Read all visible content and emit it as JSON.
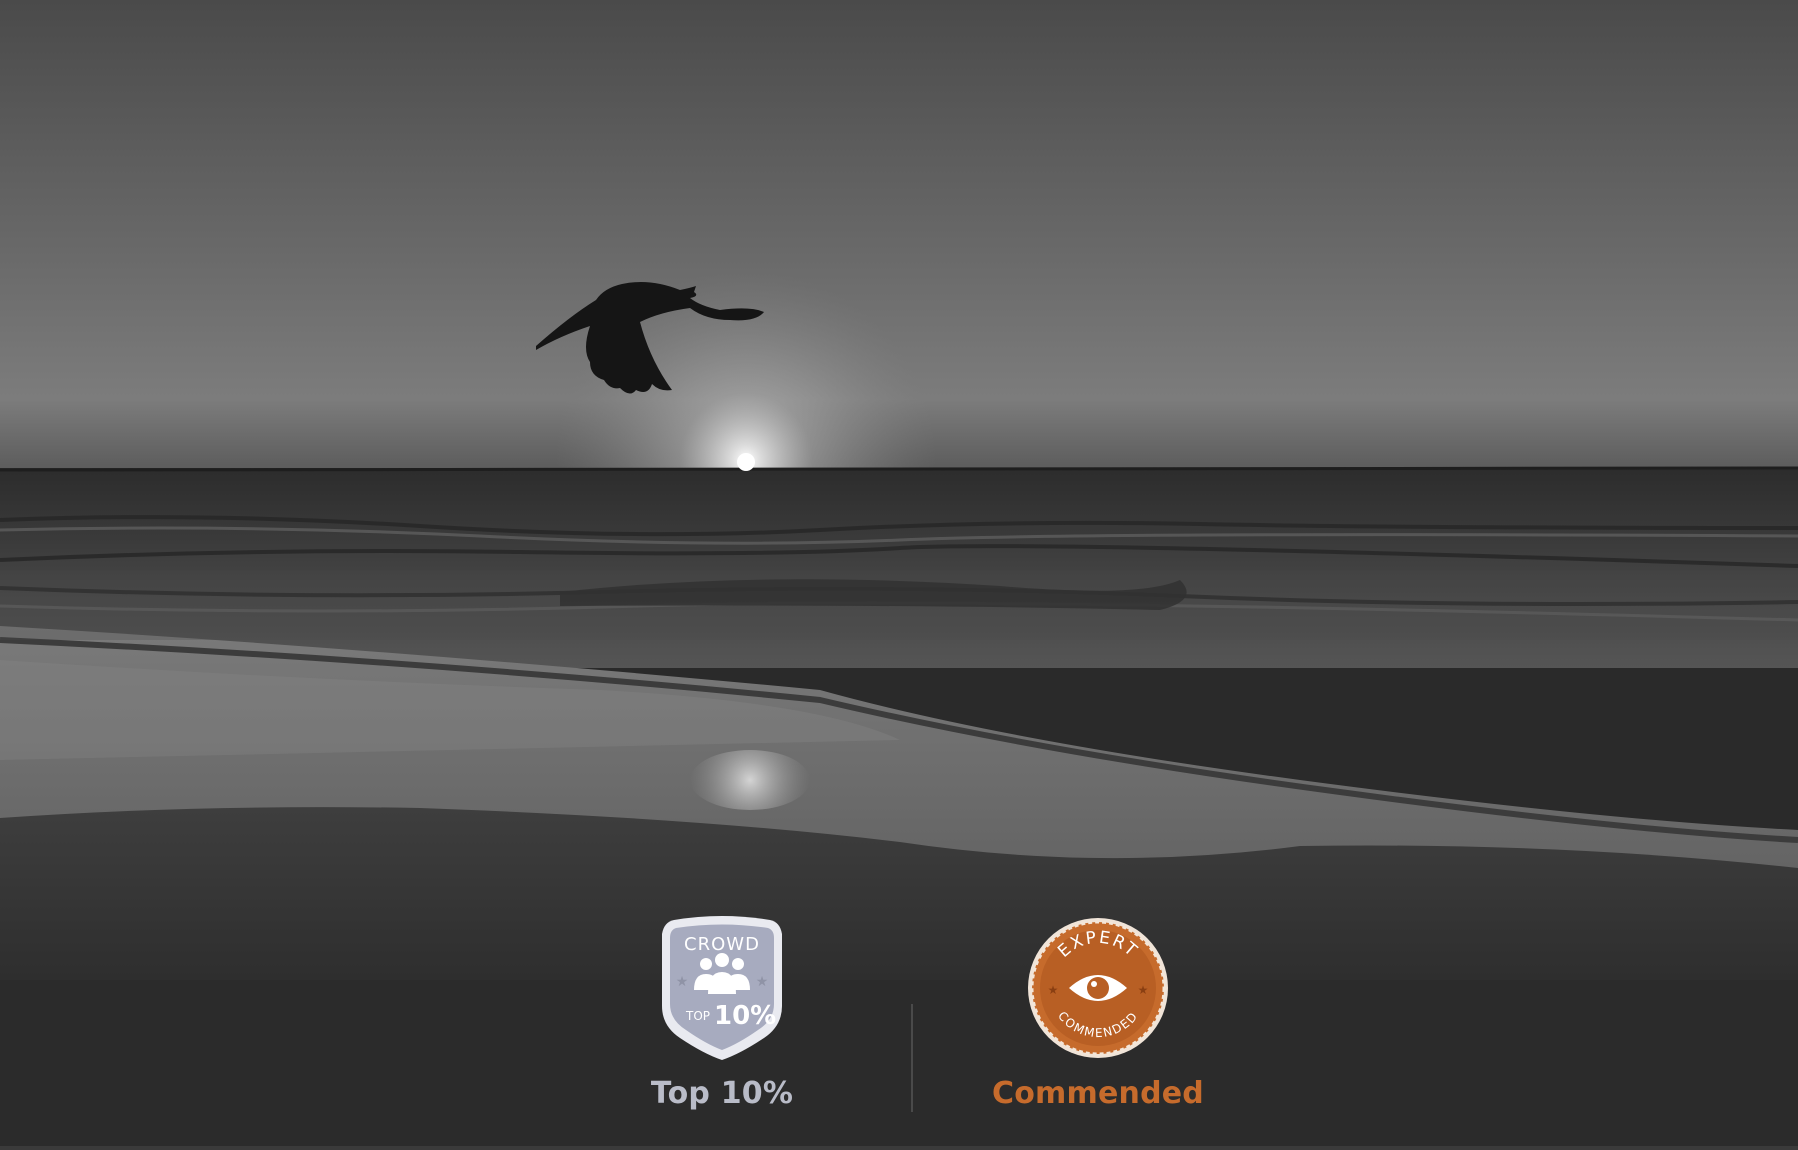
{
  "awards": {
    "crowd": {
      "badge_top_text": "CROWD",
      "badge_small_text": "TOP",
      "badge_big_text": "10%",
      "label": "Top 10%",
      "icon": "crowd-people-icon",
      "color": "#b9bcc8"
    },
    "expert": {
      "badge_top_text": "EXPERT",
      "badge_bottom_text": "COMMENDED",
      "label": "Commended",
      "icon": "eye-icon",
      "color": "#c66b2c"
    }
  },
  "colors": {
    "background": "#2b2b2b",
    "divider": "#4a4a4a"
  }
}
